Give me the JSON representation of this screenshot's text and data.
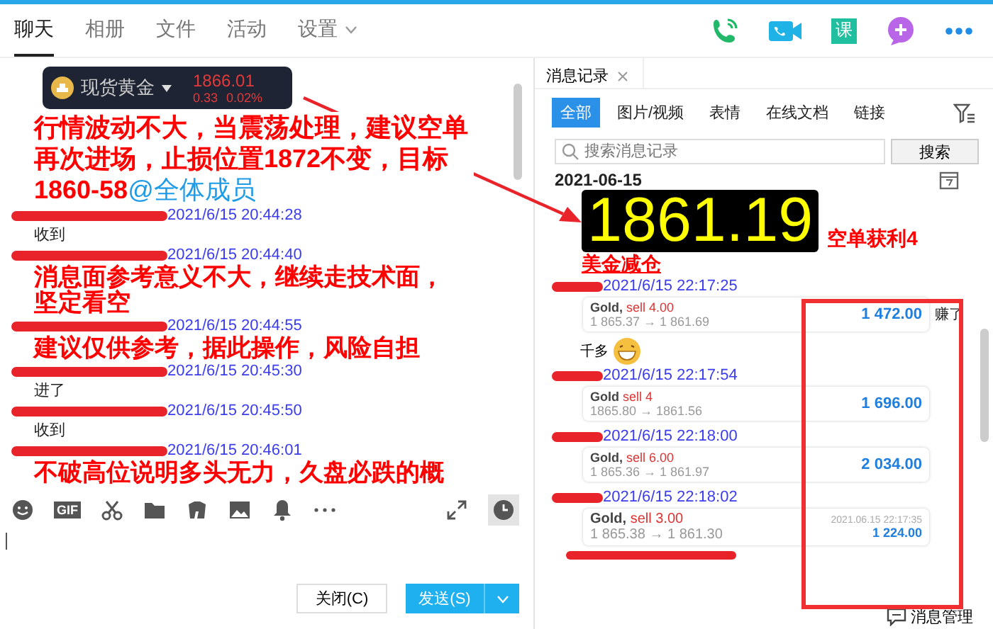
{
  "tabs": [
    {
      "label": "聊天",
      "selected": true
    },
    {
      "label": "相册",
      "selected": false
    },
    {
      "label": "文件",
      "selected": false
    },
    {
      "label": "活动",
      "selected": false
    },
    {
      "label": "设置",
      "selected": false,
      "dropdown": true
    }
  ],
  "header_icons": [
    {
      "kind": "phone"
    },
    {
      "kind": "video"
    },
    {
      "kind": "lesson"
    },
    {
      "kind": "add"
    },
    {
      "kind": "more"
    }
  ],
  "lesson_icon_text": "课",
  "messages": [
    {
      "kind": "ticker",
      "name": "现货黄金",
      "price": "1866.01",
      "change": "0.33",
      "percent": "0.02%"
    },
    {
      "kind": "headline",
      "text": "行情波动不大，当震荡处理，建议空单再次进场，止损位置1872不变，目标1860-58",
      "mention": "@全体成员"
    },
    {
      "kind": "time",
      "time": "2021/6/15 20:44:28"
    },
    {
      "kind": "text",
      "text": "收到"
    },
    {
      "kind": "time",
      "time": "2021/6/15 20:44:40"
    },
    {
      "kind": "alert",
      "text": "消息面参考意义不大，继续走技术面，坚定看空"
    },
    {
      "kind": "time",
      "time": "2021/6/15 20:44:55"
    },
    {
      "kind": "alert",
      "text": "建议仅供参考，据此操作，风险自担"
    },
    {
      "kind": "time",
      "time": "2021/6/15 20:45:30"
    },
    {
      "kind": "text",
      "text": "进了"
    },
    {
      "kind": "time",
      "time": "2021/6/15 20:45:50"
    },
    {
      "kind": "text",
      "text": "收到"
    },
    {
      "kind": "time",
      "time": "2021/6/15 20:46:01"
    },
    {
      "kind": "alert",
      "text": "不破高位说明多头无力，久盘必跌的概"
    }
  ],
  "toolbar": [
    {
      "kind": "emoji"
    },
    {
      "kind": "gif"
    },
    {
      "kind": "scissors"
    },
    {
      "kind": "folder"
    },
    {
      "kind": "shirt"
    },
    {
      "kind": "image"
    },
    {
      "kind": "bell"
    },
    {
      "kind": "more"
    },
    {
      "kind": "expand"
    },
    {
      "kind": "clock"
    }
  ],
  "gif_label": "GIF",
  "buttons": {
    "close": "关闭(C)",
    "send": "发送(S)"
  },
  "history": {
    "title": "消息记录",
    "filters": [
      {
        "label": "全部",
        "selected": true
      },
      {
        "label": "图片/视频",
        "selected": false
      },
      {
        "label": "表情",
        "selected": false
      },
      {
        "label": "在线文档",
        "selected": false
      },
      {
        "label": "链接",
        "selected": false
      }
    ],
    "search": {
      "placeholder": "搜索消息记录",
      "button": "搜索"
    },
    "date": "2021-06-15",
    "items": [
      {
        "kind": "price",
        "price": "1861.19",
        "note": "空单获利4"
      },
      {
        "kind": "note",
        "text": "美金减仓"
      },
      {
        "kind": "time",
        "time": "2021/6/15 22:17:25"
      },
      {
        "kind": "trade",
        "symbol": "Gold,",
        "side": "sell 4.00",
        "prices": "1 865.37 → 1 861.69",
        "profit": "1 472.00",
        "aside": "赚了"
      },
      {
        "kind": "text",
        "text": "千多"
      },
      {
        "kind": "time",
        "time": "2021/6/15 22:17:54"
      },
      {
        "kind": "trade",
        "symbol": "Gold",
        "side": "sell 4",
        "prices": "1865.80 → 1861.56",
        "profit": "1 696.00"
      },
      {
        "kind": "time",
        "time": "2021/6/15 22:18:00"
      },
      {
        "kind": "trade",
        "symbol": "Gold,",
        "side": "sell 6.00",
        "prices": "1 865.36 → 1 861.97",
        "profit": "2 034.00"
      },
      {
        "kind": "time",
        "time": "2021/6/15 22:18:02"
      },
      {
        "kind": "trade",
        "symbol": "Gold,",
        "side": "sell 3.00",
        "prices": "1 865.38 → 1 861.30",
        "profit": "1 224.00",
        "date": "2021.06.15 22:17:35"
      },
      {
        "kind": "redacted"
      }
    ],
    "footer": "消息管理"
  }
}
